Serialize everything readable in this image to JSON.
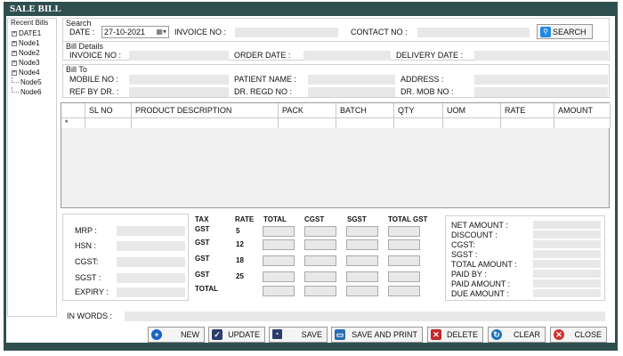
{
  "window": {
    "title": "SALE BILL"
  },
  "recent_bills": {
    "title": "Recent Bills",
    "items": [
      {
        "label": "DATE1",
        "expandable": true
      },
      {
        "label": "Node1",
        "expandable": true
      },
      {
        "label": "Node2",
        "expandable": true
      },
      {
        "label": "Node3",
        "expandable": true
      },
      {
        "label": "Node4",
        "expandable": true
      },
      {
        "label": "Node5",
        "expandable": false
      },
      {
        "label": "Node6",
        "expandable": false
      }
    ]
  },
  "search": {
    "group": "Search",
    "date_label": "DATE :",
    "date_value": "27-10-2021",
    "invoice_label": "INVOICE NO :",
    "contact_label": "CONTACT NO :",
    "button": "SEARCH"
  },
  "bill_details": {
    "group": "Bill Details",
    "invoice_label": "INVOICE NO :",
    "order_date_label": "ORDER DATE :",
    "delivery_date_label": "DELIVERY DATE :"
  },
  "bill_to": {
    "group": "Bill To",
    "mobile_label": "MOBILE NO :",
    "patient_label": "PATIENT NAME :",
    "address_label": "ADDRESS :",
    "ref_label": "REF BY DR. :",
    "regd_label": "DR. REGD NO :",
    "mob_label": "DR. MOB NO :"
  },
  "grid": {
    "columns": [
      "SL NO",
      "PRODUCT DESCRIPTION",
      "PACK",
      "BATCH",
      "QTY",
      "UOM",
      "RATE",
      "AMOUNT"
    ],
    "new_row_marker": "*"
  },
  "product_info": {
    "mrp": "MRP :",
    "hsn": "HSN :",
    "cgst": "CGST:",
    "sgst": "SGST :",
    "expiry": "EXPIRY :"
  },
  "tax": {
    "headers": [
      "TAX",
      "RATE",
      "TOTAL",
      "CGST",
      "SGST",
      "TOTAL GST"
    ],
    "rows": [
      {
        "tax": "GST",
        "rate": "5"
      },
      {
        "tax": "GST",
        "rate": "12"
      },
      {
        "tax": "GST",
        "rate": "18"
      },
      {
        "tax": "GST",
        "rate": "25"
      },
      {
        "tax": "TOTAL",
        "rate": ""
      }
    ]
  },
  "summary": [
    "NET AMOUNT :",
    "DISCOUNT :",
    "CGST:",
    "SGST :",
    "TOTAL AMOUNT :",
    "PAID BY :",
    "PAID AMOUNT :",
    "DUE AMOUNT :"
  ],
  "in_words": {
    "label": "IN WORDS :"
  },
  "buttons": {
    "new": "NEW",
    "update": "UPDATE",
    "save": "SAVE",
    "save_print": "SAVE AND PRINT",
    "delete": "DELETE",
    "clear": "CLEAR",
    "close": "CLOSE"
  },
  "colors": {
    "titlebar": "#2f4f4f",
    "search_icon": "#1e88e5",
    "new_icon": "#1565c0",
    "delete_icon": "#c62828",
    "close_icon": "#d32f2f"
  }
}
